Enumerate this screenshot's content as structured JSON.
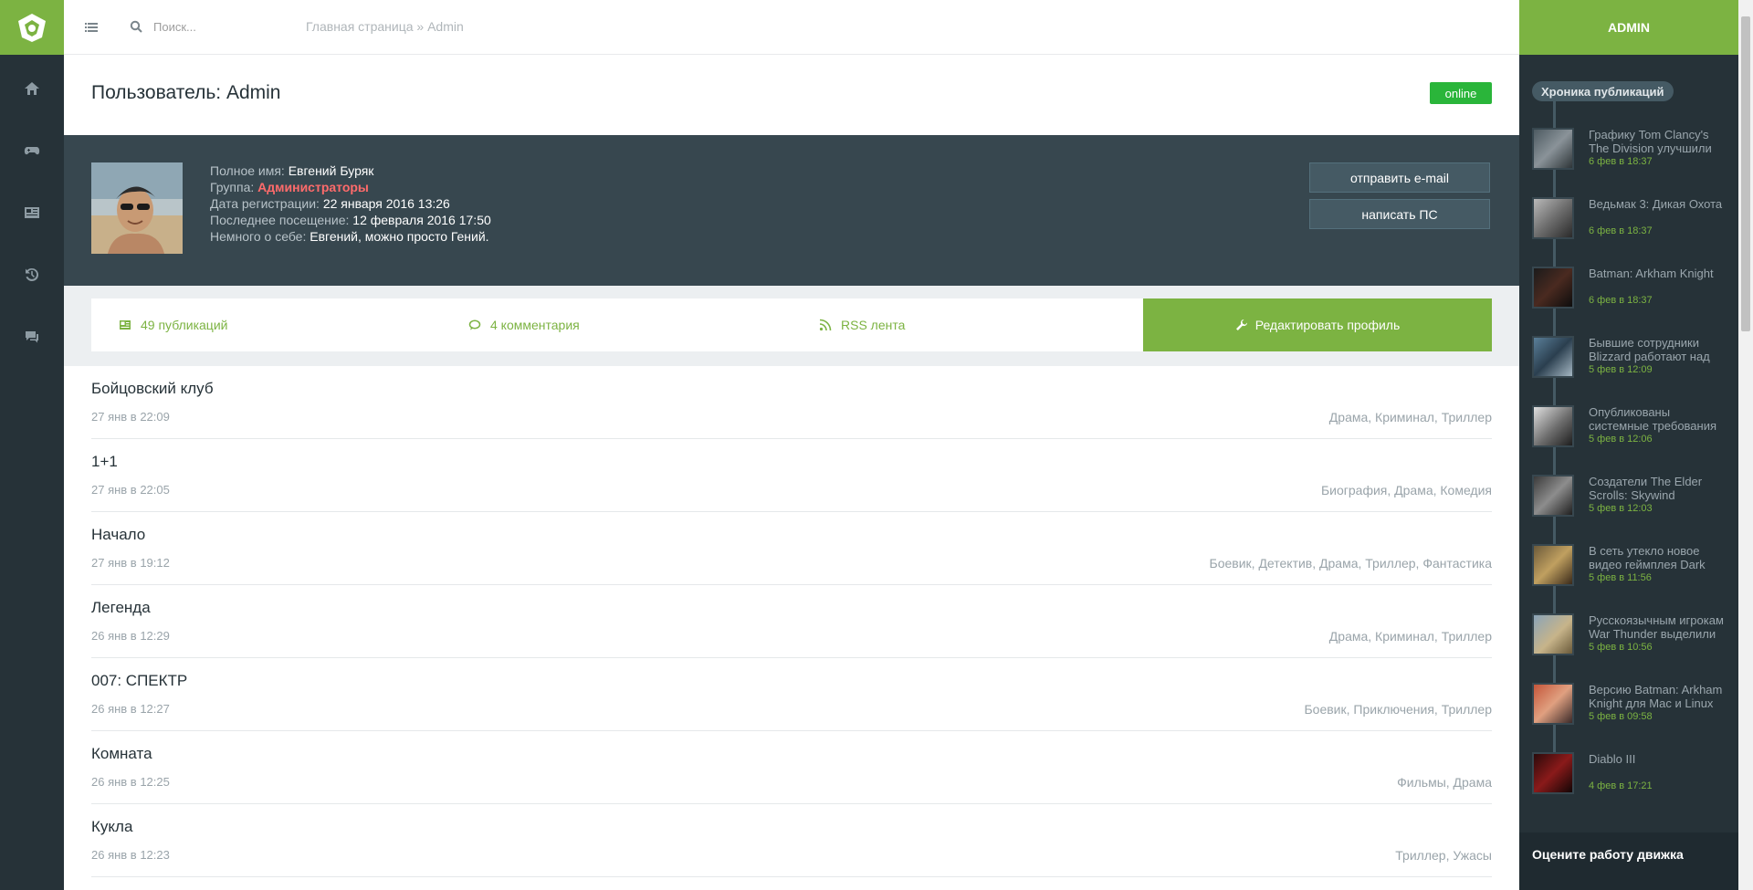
{
  "header": {
    "search_placeholder": "Поиск...",
    "breadcrumb": "Главная страница » Admin"
  },
  "page": {
    "title": "Пользователь: Admin",
    "status": "online"
  },
  "profile": {
    "fullname_label": "Полное имя:",
    "fullname": "Евгений Буряк",
    "group_label": "Группа:",
    "group": "Администраторы",
    "reg_label": "Дата регистрации:",
    "reg_date": "22 января 2016 13:26",
    "last_label": "Последнее посещение:",
    "last_visit": "12 февраля 2016 17:50",
    "about_label": "Немного о себе:",
    "about": "Евгений, можно просто Гений.",
    "send_email": "отправить e-mail",
    "write_pm": "написать ПС"
  },
  "stats": {
    "publications": "49 публикаций",
    "comments": "4 комментария",
    "rss": "RSS лента",
    "edit_profile": "Редактировать профиль"
  },
  "posts": [
    {
      "title": "Бойцовский клуб",
      "date": "27 янв в 22:09",
      "genres": "Драма, Криминал, Триллер"
    },
    {
      "title": "1+1",
      "date": "27 янв в 22:05",
      "genres": "Биография, Драма, Комедия"
    },
    {
      "title": "Начало",
      "date": "27 янв в 19:12",
      "genres": "Боевик, Детектив, Драма, Триллер, Фантастика"
    },
    {
      "title": "Легенда",
      "date": "26 янв в 12:29",
      "genres": "Драма, Криминал, Триллер"
    },
    {
      "title": "007: СПЕКТР",
      "date": "26 янв в 12:27",
      "genres": "Боевик, Приключения, Триллер"
    },
    {
      "title": "Комната",
      "date": "26 янв в 12:25",
      "genres": "Фильмы, Драма"
    },
    {
      "title": "Кукла",
      "date": "26 янв в 12:23",
      "genres": "Триллер, Ужасы"
    }
  ],
  "sidebar": {
    "user": "ADMIN",
    "timeline_title": "Хроника публикаций",
    "items": [
      {
        "title": "Графику Tom Clancy's The Division улучшили",
        "date": "6 фев в 18:37"
      },
      {
        "title": "Ведьмак 3: Дикая Охота",
        "date": "6 фев в 18:37"
      },
      {
        "title": "Batman: Arkham Knight",
        "date": "6 фев в 18:37"
      },
      {
        "title": "Бывшие сотрудники Blizzard работают над",
        "date": "5 фев в 12:09"
      },
      {
        "title": "Опубликованы системные требования",
        "date": "5 фев в 12:06"
      },
      {
        "title": "Создатели The Elder Scrolls: Skywind",
        "date": "5 фев в 12:03"
      },
      {
        "title": "В сеть утекло новое видео геймплея Dark",
        "date": "5 фев в 11:56"
      },
      {
        "title": "Русскоязычным игрокам War Thunder выделили",
        "date": "5 фев в 10:56"
      },
      {
        "title": "Версию Batman: Arkham Knight для Mac и Linux",
        "date": "5 фев в 09:58"
      },
      {
        "title": "Diablo III",
        "date": "4 фев в 17:21"
      }
    ],
    "rate_title": "Оцените работу движка"
  },
  "icons": [
    "logo-icon",
    "home-icon",
    "gamepad-icon",
    "news-icon",
    "history-icon",
    "chat-icon",
    "menu-icon",
    "search-icon",
    "newspaper-icon",
    "comment-icon",
    "rss-icon",
    "wrench-icon"
  ],
  "colors": {
    "accent": "#7cb342",
    "dark": "#263238",
    "panel": "#37474f",
    "online": "#2ab53a",
    "group": "#ff6b6b"
  }
}
